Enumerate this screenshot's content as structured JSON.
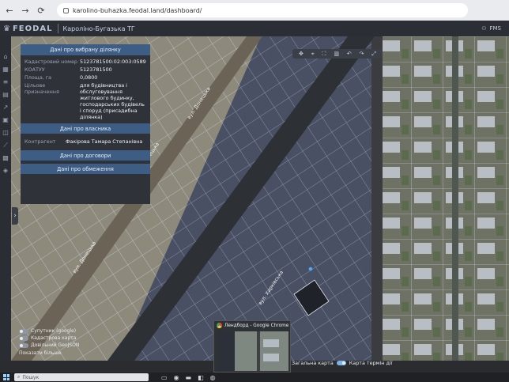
{
  "browser": {
    "url": "karolino-buhazka.feodal.land/dashboard/",
    "back_glyph": "←",
    "forward_glyph": "→",
    "reload_glyph": "⟳"
  },
  "app": {
    "logo_text": "FEODAL",
    "community_name": "Кароліно-Бугазька ТГ",
    "user_label": "FMS"
  },
  "panel": {
    "title": "Дані про вибрану ділянку",
    "rows": [
      {
        "key": "Кадастровий номер",
        "value": "5123781500:02:003:0589"
      },
      {
        "key": "КОАТУУ",
        "value": "5123781500"
      },
      {
        "key": "Площа, га",
        "value": "0,0800"
      },
      {
        "key": "Цільове призначення",
        "value": "для будівництва і обслуговування житлового будинку, господарських будівель і споруд (присадибна ділянка)"
      }
    ],
    "owner_section": "Дані про власника",
    "owner_key": "Контрагент",
    "owner_value": "Факірова Тамара Степанівна",
    "contract_section": "Дані про договори",
    "encumbrance_section": "Дані про обмеження"
  },
  "map": {
    "street_1": "вул. Донецька",
    "street_2": "вул. Донецька",
    "street_3": "вул. Харківська",
    "street_4": "вул. Донецька"
  },
  "layers": {
    "items": [
      {
        "label": "Супутник (google)"
      },
      {
        "label": "Кадастрова карта"
      },
      {
        "label": "Довільний GeoJSON"
      }
    ],
    "show_more": "Показати більше"
  },
  "map_switch": {
    "left_label": "Загальна карта",
    "right_label": "Карта термін дії"
  },
  "popup": {
    "title": "Лендборд - Google Chrome"
  },
  "taskbar": {
    "search_placeholder": "Пошук"
  },
  "colors": {
    "panel_accent": "#3d5d85",
    "parcel_fill": "#4b5266",
    "selected_parcel": "#22252e",
    "selected_dot": "#4aa8ff"
  }
}
